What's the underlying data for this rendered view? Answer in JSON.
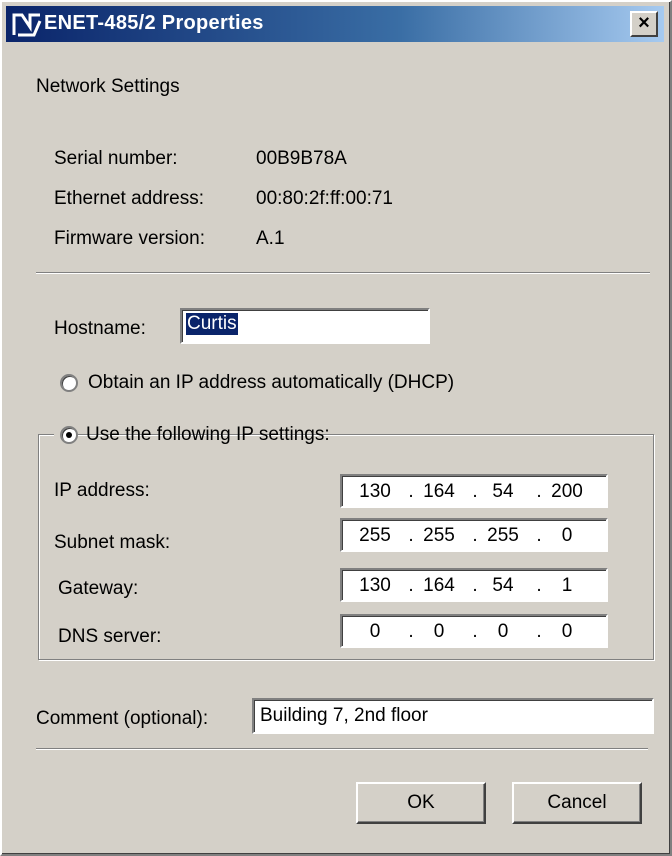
{
  "window": {
    "title": "ENET-485/2 Properties",
    "close_label": "×"
  },
  "section_title": "Network Settings",
  "info": {
    "serial_label": "Serial number:",
    "serial_value": "00B9B78A",
    "ethernet_label": "Ethernet address:",
    "ethernet_value": "00:80:2f:ff:00:71",
    "firmware_label": "Firmware version:",
    "firmware_value": "A.1"
  },
  "hostname": {
    "label": "Hostname:",
    "value": "Curtis"
  },
  "ip_mode": {
    "dhcp_label": "Obtain an IP address automatically (DHCP)",
    "static_label": "Use the following IP settings:",
    "selected": "static"
  },
  "ip_settings": {
    "ip_label": "IP address:",
    "ip": [
      "130",
      "164",
      "54",
      "200"
    ],
    "subnet_label": "Subnet mask:",
    "subnet": [
      "255",
      "255",
      "255",
      "0"
    ],
    "gateway_label": "Gateway:",
    "gateway": [
      "130",
      "164",
      "54",
      "1"
    ],
    "dns_label": "DNS server:",
    "dns": [
      "0",
      "0",
      "0",
      "0"
    ],
    "dot": "."
  },
  "comment": {
    "label": "Comment (optional):",
    "value": "Building 7, 2nd floor"
  },
  "buttons": {
    "ok": "OK",
    "cancel": "Cancel"
  },
  "colors": {
    "titlebar_start": "#0a246a",
    "dialog_bg": "#d4d0c8",
    "selection": "#0a246a"
  }
}
